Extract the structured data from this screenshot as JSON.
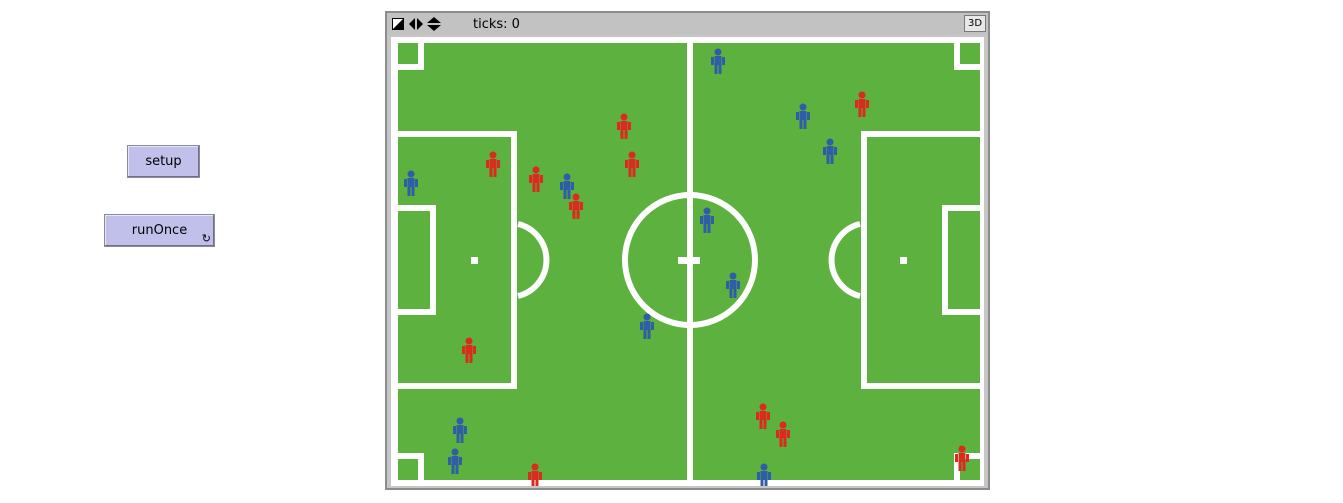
{
  "buttons": {
    "setup_label": "setup",
    "run_label": "runOnce",
    "forever_icon": "loop-arrows-icon"
  },
  "view": {
    "ticks_label": "ticks: 0",
    "btn_3d_label": "3D",
    "toolbar_icons": [
      "color-contrast-icon",
      "horizontal-arrows-icon",
      "vertical-arrows-icon"
    ]
  },
  "colors": {
    "pitch": "#5db13e",
    "lines": "#ffffff",
    "team_red": "#d92b1e",
    "team_blue": "#2f5da6",
    "button": "#c0c0ea"
  },
  "players": [
    {
      "team": "blue"
    },
    {
      "team": "red"
    },
    {
      "team": "blue"
    },
    {
      "team": "red"
    },
    {
      "team": "blue"
    },
    {
      "team": "red"
    },
    {
      "team": "red"
    },
    {
      "team": "blue"
    },
    {
      "team": "red"
    },
    {
      "team": "blue"
    },
    {
      "team": "red"
    },
    {
      "team": "blue"
    },
    {
      "team": "blue"
    },
    {
      "team": "blue"
    },
    {
      "team": "red"
    },
    {
      "team": "blue"
    },
    {
      "team": "blue"
    },
    {
      "team": "red"
    },
    {
      "team": "red"
    },
    {
      "team": "red"
    },
    {
      "team": "red"
    },
    {
      "team": "blue"
    }
  ]
}
